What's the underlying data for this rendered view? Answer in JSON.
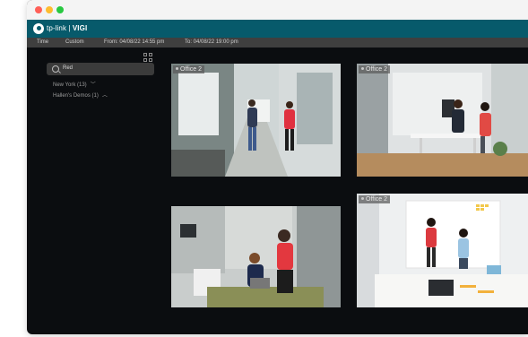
{
  "brand": {
    "logo_text": "tp-link",
    "product": "VIGI"
  },
  "filters": {
    "time_label": "Time",
    "range_value": "Custom",
    "from_text": "From: 04/08/22 14:55 pm",
    "to_text": "To: 04/08/22 19:00 pm"
  },
  "sidebar": {
    "search_value": "Red",
    "tree": [
      {
        "label": "New York (13)"
      },
      {
        "label": "Hallen's Demos (1)"
      }
    ]
  },
  "cameras": [
    {
      "label": "Office 2"
    },
    {
      "label": "Office 2"
    },
    {
      "label": ""
    },
    {
      "label": "Office 2"
    }
  ],
  "colors": {
    "brand_bar": "#075a6b",
    "window_bg": "#0b0d10",
    "filter_bar": "#3f3f3f",
    "search_bg": "#3b3b3b"
  },
  "icons": [
    "grid-layout-icon",
    "search-icon",
    "chevron-down-icon",
    "chevron-up-icon",
    "recording-dot-icon"
  ]
}
